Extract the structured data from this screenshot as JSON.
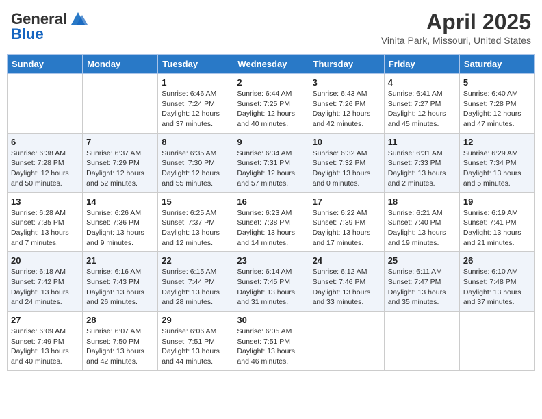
{
  "header": {
    "logo_line1": "General",
    "logo_line2": "Blue",
    "month_title": "April 2025",
    "location": "Vinita Park, Missouri, United States"
  },
  "weekdays": [
    "Sunday",
    "Monday",
    "Tuesday",
    "Wednesday",
    "Thursday",
    "Friday",
    "Saturday"
  ],
  "weeks": [
    [
      {
        "day": "",
        "sunrise": "",
        "sunset": "",
        "daylight": ""
      },
      {
        "day": "",
        "sunrise": "",
        "sunset": "",
        "daylight": ""
      },
      {
        "day": "1",
        "sunrise": "Sunrise: 6:46 AM",
        "sunset": "Sunset: 7:24 PM",
        "daylight": "Daylight: 12 hours and 37 minutes."
      },
      {
        "day": "2",
        "sunrise": "Sunrise: 6:44 AM",
        "sunset": "Sunset: 7:25 PM",
        "daylight": "Daylight: 12 hours and 40 minutes."
      },
      {
        "day": "3",
        "sunrise": "Sunrise: 6:43 AM",
        "sunset": "Sunset: 7:26 PM",
        "daylight": "Daylight: 12 hours and 42 minutes."
      },
      {
        "day": "4",
        "sunrise": "Sunrise: 6:41 AM",
        "sunset": "Sunset: 7:27 PM",
        "daylight": "Daylight: 12 hours and 45 minutes."
      },
      {
        "day": "5",
        "sunrise": "Sunrise: 6:40 AM",
        "sunset": "Sunset: 7:28 PM",
        "daylight": "Daylight: 12 hours and 47 minutes."
      }
    ],
    [
      {
        "day": "6",
        "sunrise": "Sunrise: 6:38 AM",
        "sunset": "Sunset: 7:28 PM",
        "daylight": "Daylight: 12 hours and 50 minutes."
      },
      {
        "day": "7",
        "sunrise": "Sunrise: 6:37 AM",
        "sunset": "Sunset: 7:29 PM",
        "daylight": "Daylight: 12 hours and 52 minutes."
      },
      {
        "day": "8",
        "sunrise": "Sunrise: 6:35 AM",
        "sunset": "Sunset: 7:30 PM",
        "daylight": "Daylight: 12 hours and 55 minutes."
      },
      {
        "day": "9",
        "sunrise": "Sunrise: 6:34 AM",
        "sunset": "Sunset: 7:31 PM",
        "daylight": "Daylight: 12 hours and 57 minutes."
      },
      {
        "day": "10",
        "sunrise": "Sunrise: 6:32 AM",
        "sunset": "Sunset: 7:32 PM",
        "daylight": "Daylight: 13 hours and 0 minutes."
      },
      {
        "day": "11",
        "sunrise": "Sunrise: 6:31 AM",
        "sunset": "Sunset: 7:33 PM",
        "daylight": "Daylight: 13 hours and 2 minutes."
      },
      {
        "day": "12",
        "sunrise": "Sunrise: 6:29 AM",
        "sunset": "Sunset: 7:34 PM",
        "daylight": "Daylight: 13 hours and 5 minutes."
      }
    ],
    [
      {
        "day": "13",
        "sunrise": "Sunrise: 6:28 AM",
        "sunset": "Sunset: 7:35 PM",
        "daylight": "Daylight: 13 hours and 7 minutes."
      },
      {
        "day": "14",
        "sunrise": "Sunrise: 6:26 AM",
        "sunset": "Sunset: 7:36 PM",
        "daylight": "Daylight: 13 hours and 9 minutes."
      },
      {
        "day": "15",
        "sunrise": "Sunrise: 6:25 AM",
        "sunset": "Sunset: 7:37 PM",
        "daylight": "Daylight: 13 hours and 12 minutes."
      },
      {
        "day": "16",
        "sunrise": "Sunrise: 6:23 AM",
        "sunset": "Sunset: 7:38 PM",
        "daylight": "Daylight: 13 hours and 14 minutes."
      },
      {
        "day": "17",
        "sunrise": "Sunrise: 6:22 AM",
        "sunset": "Sunset: 7:39 PM",
        "daylight": "Daylight: 13 hours and 17 minutes."
      },
      {
        "day": "18",
        "sunrise": "Sunrise: 6:21 AM",
        "sunset": "Sunset: 7:40 PM",
        "daylight": "Daylight: 13 hours and 19 minutes."
      },
      {
        "day": "19",
        "sunrise": "Sunrise: 6:19 AM",
        "sunset": "Sunset: 7:41 PM",
        "daylight": "Daylight: 13 hours and 21 minutes."
      }
    ],
    [
      {
        "day": "20",
        "sunrise": "Sunrise: 6:18 AM",
        "sunset": "Sunset: 7:42 PM",
        "daylight": "Daylight: 13 hours and 24 minutes."
      },
      {
        "day": "21",
        "sunrise": "Sunrise: 6:16 AM",
        "sunset": "Sunset: 7:43 PM",
        "daylight": "Daylight: 13 hours and 26 minutes."
      },
      {
        "day": "22",
        "sunrise": "Sunrise: 6:15 AM",
        "sunset": "Sunset: 7:44 PM",
        "daylight": "Daylight: 13 hours and 28 minutes."
      },
      {
        "day": "23",
        "sunrise": "Sunrise: 6:14 AM",
        "sunset": "Sunset: 7:45 PM",
        "daylight": "Daylight: 13 hours and 31 minutes."
      },
      {
        "day": "24",
        "sunrise": "Sunrise: 6:12 AM",
        "sunset": "Sunset: 7:46 PM",
        "daylight": "Daylight: 13 hours and 33 minutes."
      },
      {
        "day": "25",
        "sunrise": "Sunrise: 6:11 AM",
        "sunset": "Sunset: 7:47 PM",
        "daylight": "Daylight: 13 hours and 35 minutes."
      },
      {
        "day": "26",
        "sunrise": "Sunrise: 6:10 AM",
        "sunset": "Sunset: 7:48 PM",
        "daylight": "Daylight: 13 hours and 37 minutes."
      }
    ],
    [
      {
        "day": "27",
        "sunrise": "Sunrise: 6:09 AM",
        "sunset": "Sunset: 7:49 PM",
        "daylight": "Daylight: 13 hours and 40 minutes."
      },
      {
        "day": "28",
        "sunrise": "Sunrise: 6:07 AM",
        "sunset": "Sunset: 7:50 PM",
        "daylight": "Daylight: 13 hours and 42 minutes."
      },
      {
        "day": "29",
        "sunrise": "Sunrise: 6:06 AM",
        "sunset": "Sunset: 7:51 PM",
        "daylight": "Daylight: 13 hours and 44 minutes."
      },
      {
        "day": "30",
        "sunrise": "Sunrise: 6:05 AM",
        "sunset": "Sunset: 7:51 PM",
        "daylight": "Daylight: 13 hours and 46 minutes."
      },
      {
        "day": "",
        "sunrise": "",
        "sunset": "",
        "daylight": ""
      },
      {
        "day": "",
        "sunrise": "",
        "sunset": "",
        "daylight": ""
      },
      {
        "day": "",
        "sunrise": "",
        "sunset": "",
        "daylight": ""
      }
    ]
  ]
}
